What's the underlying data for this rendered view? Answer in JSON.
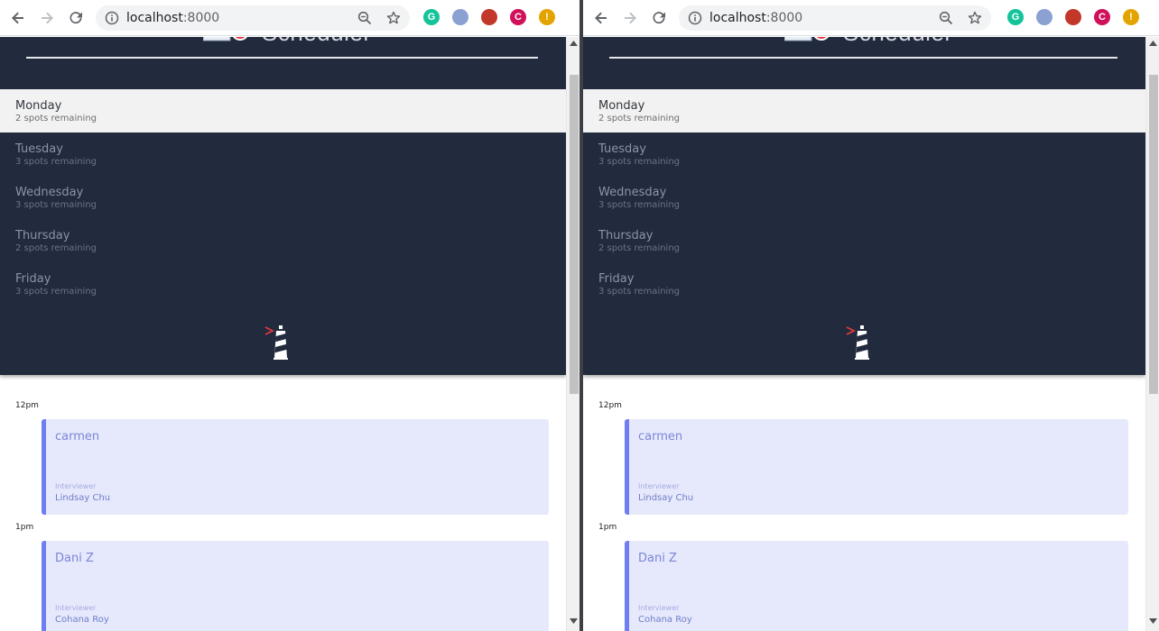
{
  "browser": {
    "url_host": "localhost",
    "url_port": ":8000",
    "icons": [
      "back-arrow-icon",
      "forward-arrow-icon",
      "reload-icon",
      "info-icon",
      "zoom-icon",
      "star-icon"
    ],
    "extensions": [
      {
        "name": "grammarly-icon",
        "color": "#15c39a",
        "glyph": "G"
      },
      {
        "name": "extension-circle-icon",
        "color": "#8aa1d1",
        "glyph": ""
      },
      {
        "name": "extension-puzzle-icon",
        "color": "#c2372a",
        "glyph": ""
      },
      {
        "name": "profile-avatar",
        "color": "#d0105a",
        "glyph": "C"
      },
      {
        "name": "update-alert-icon",
        "color": "#e3a400",
        "glyph": "!"
      }
    ]
  },
  "app": {
    "title": "Scheduler",
    "days": [
      {
        "name": "Monday",
        "spots": "2 spots remaining",
        "selected": true
      },
      {
        "name": "Tuesday",
        "spots": "3 spots remaining",
        "selected": false
      },
      {
        "name": "Wednesday",
        "spots": "3 spots remaining",
        "selected": false
      },
      {
        "name": "Thursday",
        "spots": "2 spots remaining",
        "selected": false
      },
      {
        "name": "Friday",
        "spots": "3 spots remaining",
        "selected": false
      }
    ],
    "appointments": [
      {
        "time": "12pm",
        "student": "carmen",
        "interviewer_label": "Interviewer",
        "interviewer": "Lindsay Chu"
      },
      {
        "time": "1pm",
        "student": "Dani Z",
        "interviewer_label": "Interviewer",
        "interviewer": "Cohana Roy"
      }
    ]
  },
  "colors": {
    "sidebar": "#222a3d",
    "selected_day": "#f2f2f2",
    "appointment_bg": "#e6e9fb",
    "appointment_accent": "#6f7ef0"
  }
}
